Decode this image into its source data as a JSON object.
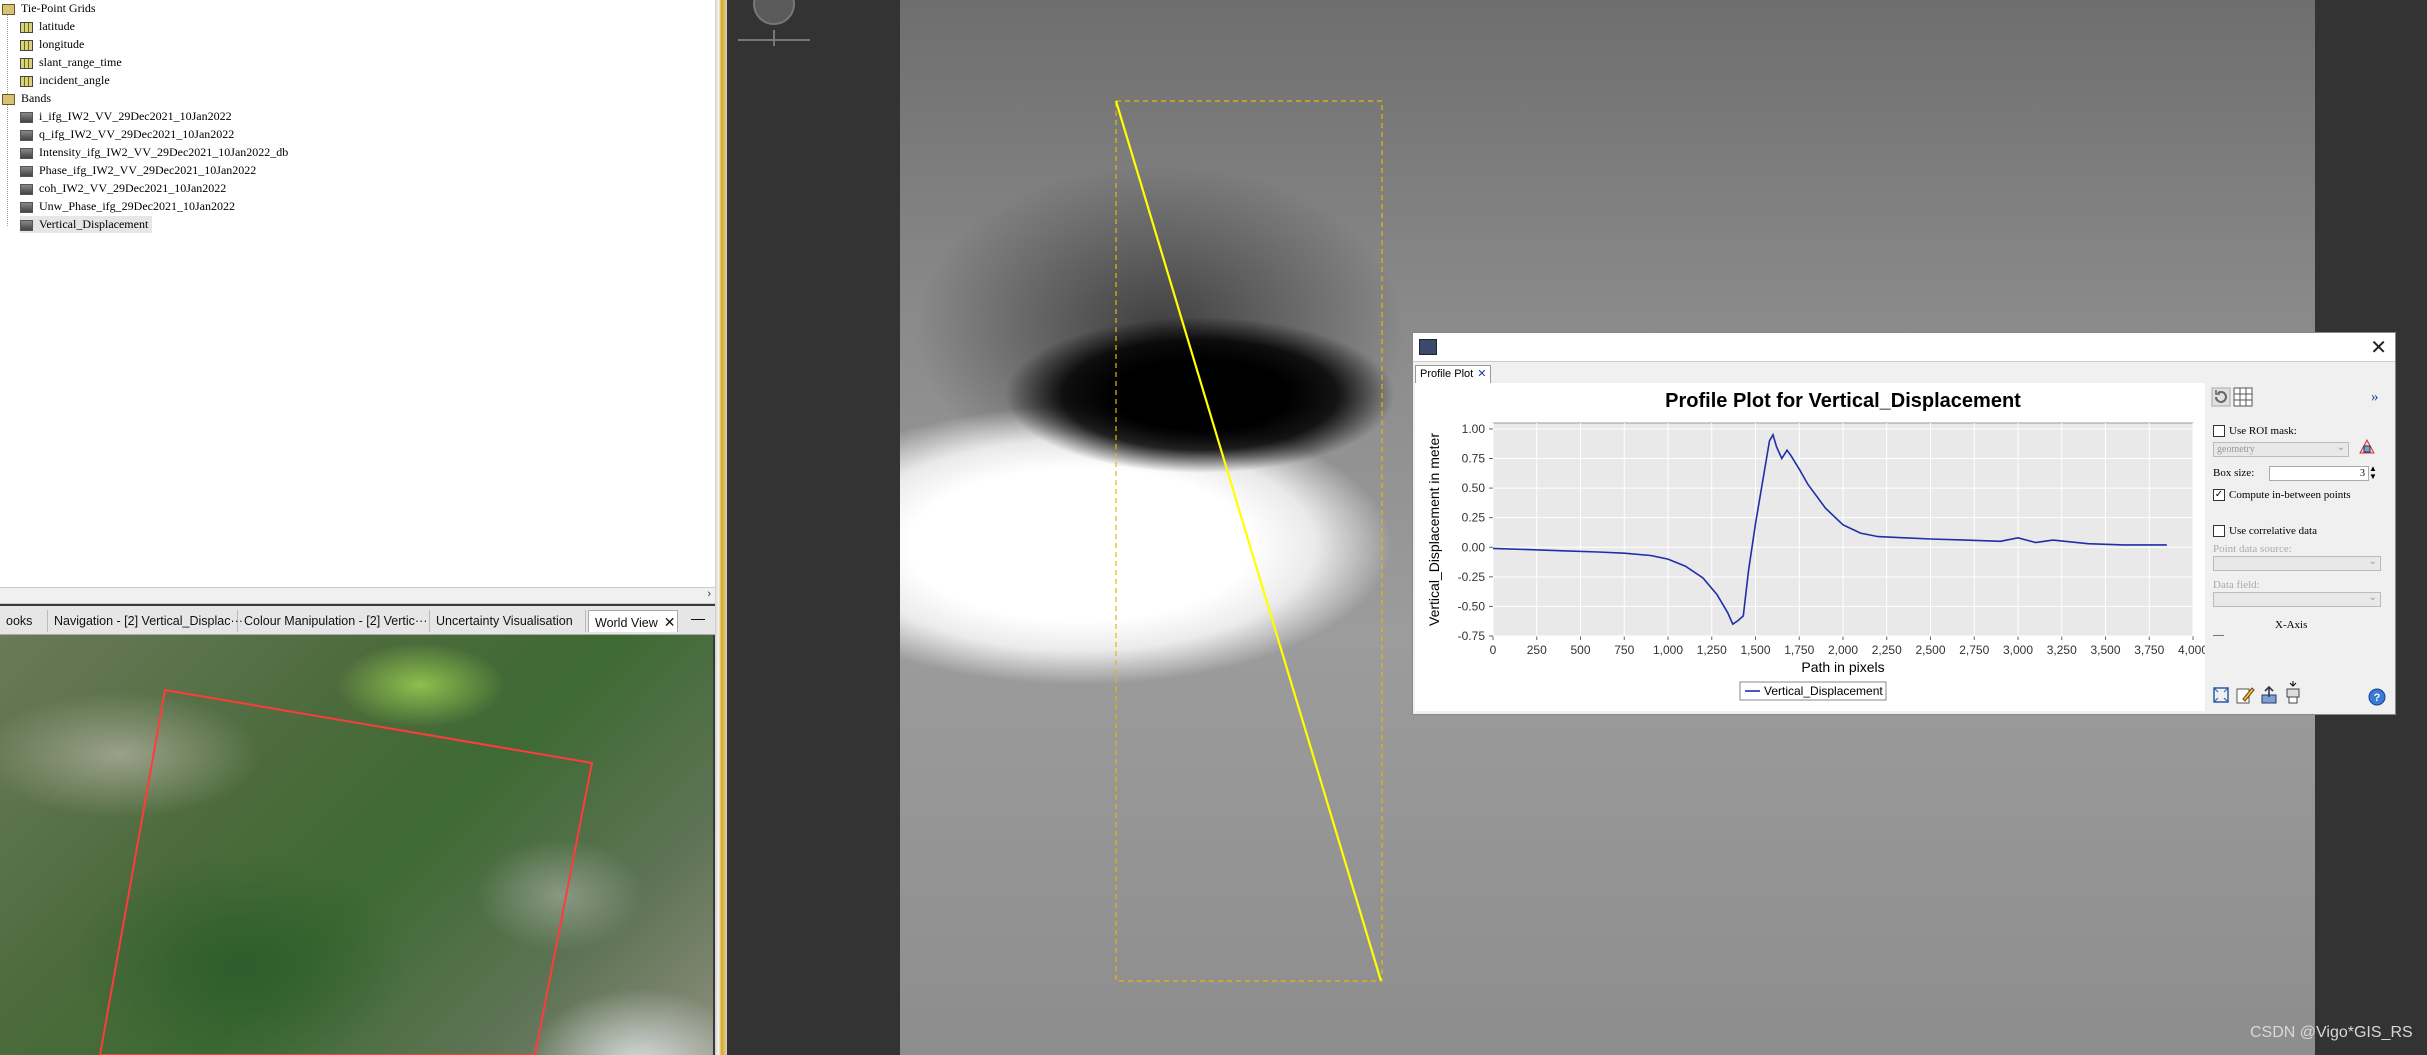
{
  "tree": {
    "tie_point_group": "Tie-Point Grids",
    "tie_points": [
      "latitude",
      "longitude",
      "slant_range_time",
      "incident_angle"
    ],
    "bands_group": "Bands",
    "bands": [
      "i_ifg_IW2_VV_29Dec2021_10Jan2022",
      "q_ifg_IW2_VV_29Dec2021_10Jan2022",
      "Intensity_ifg_IW2_VV_29Dec2021_10Jan2022_db",
      "Phase_ifg_IW2_VV_29Dec2021_10Jan2022",
      "coh_IW2_VV_29Dec2021_10Jan2022",
      "Unw_Phase_ifg_29Dec2021_10Jan2022",
      "Vertical_Displacement"
    ],
    "selected": "Vertical_Displacement"
  },
  "tabs": [
    {
      "label": "ooks"
    },
    {
      "label": "Navigation - [2] Vertical_Displac···"
    },
    {
      "label": "Colour Manipulation - [2] Vertic···"
    },
    {
      "label": "Uncertainty Visualisation"
    },
    {
      "label": "World View"
    }
  ],
  "tab_close": "✕",
  "tab_minimize": "—",
  "profile_window": {
    "close": "✕",
    "tab_label": "Profile Plot",
    "tab_close": "✕",
    "side": {
      "expand": "»",
      "use_roi_mask": "Use ROI mask:",
      "roi_combo": "geometry",
      "box_size_label": "Box size:",
      "box_size_value": "3",
      "compute_between": "Compute in-between points",
      "use_correlative": "Use correlative data",
      "point_source_label": "Point data source:",
      "data_field_label": "Data field:",
      "xaxis_label": "X-Axis",
      "xaxis_dash": "—"
    }
  },
  "chart_data": {
    "type": "line",
    "title": "Profile Plot for Vertical_Displacement",
    "xlabel": "Path in pixels",
    "ylabel": "Vertical_Displacement in meter",
    "xlim": [
      0,
      4000
    ],
    "ylim": [
      -0.75,
      1.05
    ],
    "xticks": [
      0,
      250,
      500,
      750,
      1000,
      1250,
      1500,
      1750,
      2000,
      2250,
      2500,
      2750,
      3000,
      3250,
      3500,
      3750,
      4000
    ],
    "xtick_labels": [
      "0",
      "250",
      "500",
      "750",
      "1,000",
      "1,250",
      "1,500",
      "1,750",
      "2,000",
      "2,250",
      "2,500",
      "2,750",
      "3,000",
      "3,250",
      "3,500",
      "3,750",
      "4,000"
    ],
    "yticks": [
      -0.75,
      -0.5,
      -0.25,
      0,
      0.25,
      0.5,
      0.75,
      1.0
    ],
    "ytick_labels": [
      "-0.75",
      "-0.50",
      "-0.25",
      "0.00",
      "0.25",
      "0.50",
      "0.75",
      "1.00"
    ],
    "grid": true,
    "legend": "bottom",
    "series": [
      {
        "name": "Vertical_Displacement",
        "color": "#1f2fa8",
        "x": [
          0,
          200,
          400,
          600,
          750,
          900,
          1000,
          1100,
          1200,
          1280,
          1340,
          1370,
          1400,
          1430,
          1460,
          1500,
          1540,
          1580,
          1600,
          1620,
          1650,
          1680,
          1700,
          1750,
          1800,
          1900,
          2000,
          2100,
          2200,
          2350,
          2500,
          2700,
          2900,
          3000,
          3100,
          3200,
          3400,
          3600,
          3850
        ],
        "y": [
          -0.01,
          -0.02,
          -0.03,
          -0.04,
          -0.05,
          -0.07,
          -0.1,
          -0.16,
          -0.26,
          -0.4,
          -0.55,
          -0.65,
          -0.62,
          -0.58,
          -0.2,
          0.2,
          0.55,
          0.9,
          0.95,
          0.85,
          0.75,
          0.82,
          0.78,
          0.66,
          0.53,
          0.33,
          0.19,
          0.12,
          0.09,
          0.08,
          0.07,
          0.06,
          0.05,
          0.08,
          0.04,
          0.06,
          0.03,
          0.02,
          0.02
        ]
      }
    ]
  },
  "watermark": "CSDN @Vigo*GIS_RS"
}
